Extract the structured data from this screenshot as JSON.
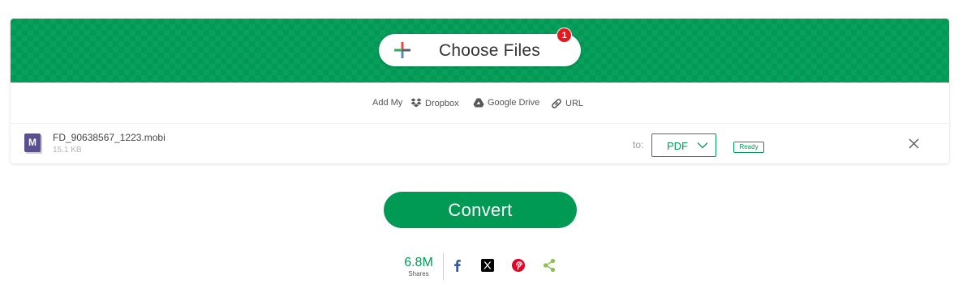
{
  "colors": {
    "brand_green": "#019a55",
    "badge_red": "#e8181f",
    "file_icon_purple": "#5a4f8f",
    "facebook": "#3b5998",
    "x": "#000000",
    "pinterest": "#e60023",
    "share": "#8bc34a"
  },
  "uploader": {
    "choose_files_label": "Choose Files",
    "file_count_badge": "1",
    "icon": "plus-icon"
  },
  "sources": {
    "add_my_label": "Add My",
    "items": [
      {
        "label": "Dropbox",
        "icon": "dropbox-icon"
      },
      {
        "label": "Google Drive",
        "icon": "google-drive-icon"
      },
      {
        "label": "URL",
        "icon": "link-icon"
      }
    ]
  },
  "file": {
    "icon_letter": "M",
    "name": "FD_90638567_1223.mobi",
    "size": "15.1 KB",
    "to_label": "to:",
    "format": "PDF",
    "status": "Ready",
    "remove_icon": "close-icon"
  },
  "convert_label": "Convert",
  "share": {
    "count": "6.8M",
    "label": "Shares",
    "buttons": [
      {
        "icon": "facebook-icon"
      },
      {
        "icon": "x-icon"
      },
      {
        "icon": "pinterest-icon"
      },
      {
        "icon": "share-icon"
      }
    ]
  }
}
